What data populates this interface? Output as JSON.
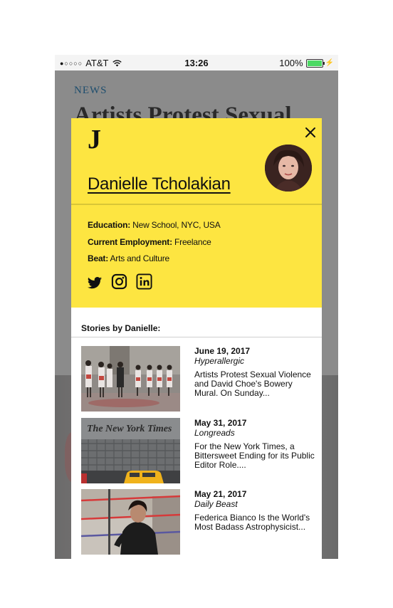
{
  "status_bar": {
    "signal_dots": "●○○○○",
    "carrier": "AT&T",
    "time": "13:26",
    "battery_percent": "100%",
    "battery_level": 1.0
  },
  "background_article": {
    "kicker": "NEWS",
    "headline": "Artists Protest Sexual"
  },
  "profile": {
    "logo": "J",
    "name": "Danielle Tcholakian",
    "education_label": "Education:",
    "education_value": "New School, NYC, USA",
    "employment_label": "Current Employment:",
    "employment_value": "Freelance",
    "beat_label": "Beat:",
    "beat_value": "Arts and Culture",
    "social_icons": [
      "twitter-icon",
      "instagram-icon",
      "linkedin-icon"
    ]
  },
  "stories_heading": "Stories by Danielle:",
  "stories": [
    {
      "date": "June 19, 2017",
      "publication": "Hyperallergic",
      "title": "Artists Protest Sexual Violence and David Choe's Bowery Mural. On Sunday..."
    },
    {
      "date": "May 31, 2017",
      "publication": "Longreads",
      "title": "For the New York Times, a Bittersweet Ending for its Public Editor Role...."
    },
    {
      "date": "May 21, 2017",
      "publication": "Daily Beast",
      "title": "Federica Bianco Is the World's Most Badass Astrophysicist..."
    }
  ],
  "colors": {
    "header_yellow": "#fde541",
    "kicker_blue": "#1e4e6e",
    "overlay_gray": "#8a8a8a"
  }
}
